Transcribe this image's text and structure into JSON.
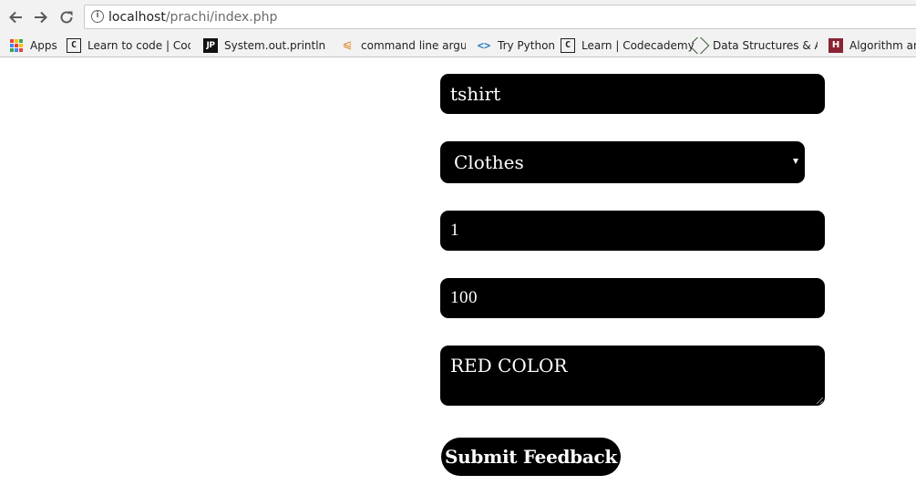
{
  "browser": {
    "url_host": "localhost",
    "url_path": "/prachi/index.php",
    "info_glyph": "i",
    "bookmarks": [
      {
        "label": "Apps",
        "icon": "apps-grid-icon"
      },
      {
        "label": "Learn to code | Code",
        "icon": "codecademy-icon",
        "icon_glyph": "C"
      },
      {
        "label": "System.out.println - J",
        "icon": "javatpoint-icon",
        "icon_glyph": "JP"
      },
      {
        "label": "command line argum",
        "icon": "stackoverflow-icon",
        "icon_glyph": "⩿"
      },
      {
        "label": "Try Python",
        "icon": "code-brackets-icon",
        "icon_glyph": "<>"
      },
      {
        "label": "Learn | Codecademy",
        "icon": "codecademy-icon",
        "icon_glyph": "C"
      },
      {
        "label": "Data Structures & Alg",
        "icon": "diamond-logo-icon"
      },
      {
        "label": "Algorithm and",
        "icon": "hackerrank-icon",
        "icon_glyph": "H"
      }
    ],
    "apps_colors": [
      "#ea4335",
      "#fbbc05",
      "#34a853",
      "#4285f4",
      "#ea4335",
      "#fbbc05",
      "#34a853",
      "#4285f4",
      "#ea4335"
    ]
  },
  "form": {
    "name_value": "tshirt",
    "category_value": "Clothes",
    "quantity_value": "1",
    "price_value": "100",
    "description_value": "RED COLOR",
    "submit_label": "Submit Feedback"
  },
  "colors": {
    "field_bg": "#000000",
    "field_text": "#ffffff"
  }
}
